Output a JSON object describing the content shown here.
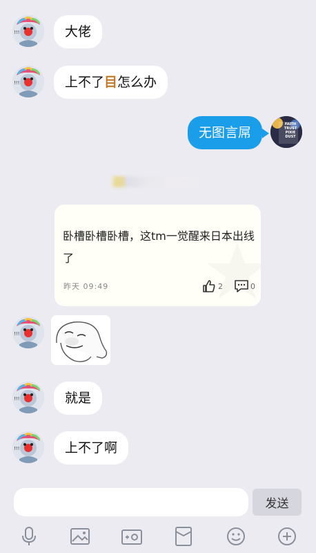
{
  "messages": [
    {
      "text": "大佬"
    },
    {
      "text_pre": "上不了",
      "text_glyph": "目",
      "text_post": "怎么办"
    },
    {
      "text": "无图言屌"
    },
    {
      "text": "就是"
    },
    {
      "text": "上不了啊"
    }
  ],
  "my_avatar": {
    "line1": "FAITH",
    "line2": "TRUST",
    "line3": "PIXIE",
    "line4": "DUST"
  },
  "post_card": {
    "text": "卧槽卧槽卧槽，这tm一觉醒来日本出线了",
    "time": "昨天 09:49",
    "like_count": "2",
    "comment_count": "0"
  },
  "composer": {
    "placeholder": "",
    "send_label": "发送"
  },
  "toolbar": [
    "mic-icon",
    "image-icon",
    "camera-icon",
    "red-packet-icon",
    "emoji-icon",
    "plus-icon"
  ],
  "colors": {
    "background": "#ebebf1",
    "my_bubble": "#1a9eea",
    "their_bubble": "#ffffff"
  }
}
